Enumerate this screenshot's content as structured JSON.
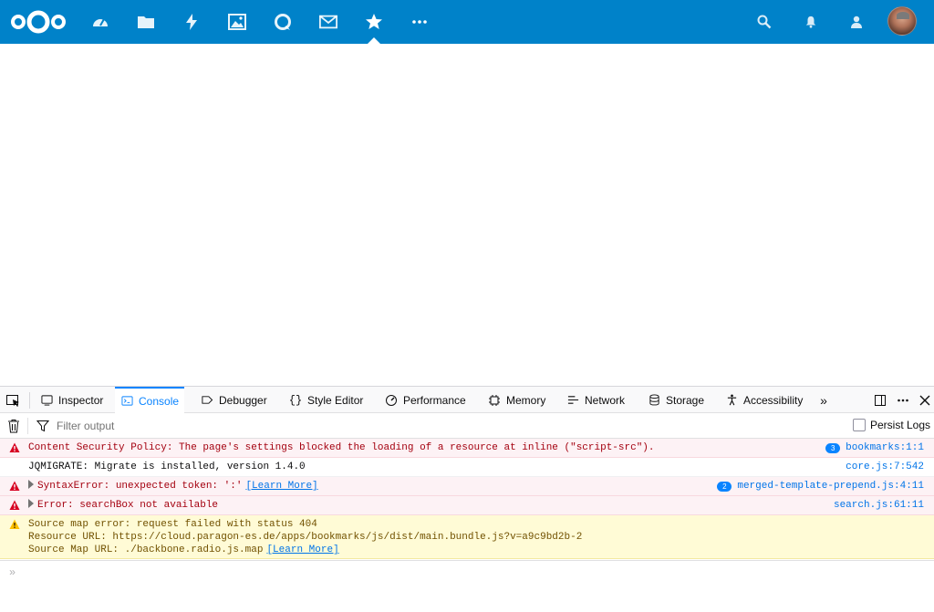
{
  "colors": {
    "header_bg": "#0082c9",
    "devtools_accent": "#0a84ff",
    "error_text": "#a4000f",
    "error_bg": "#fdf2f5",
    "warn_text": "#715100",
    "warn_bg": "#fffbd6",
    "link": "#0074e8"
  },
  "header": {
    "logo_icon": "nextcloud-logo",
    "apps": [
      {
        "icon": "dashboard-icon",
        "active": false
      },
      {
        "icon": "files-icon",
        "active": false
      },
      {
        "icon": "activity-icon",
        "active": false
      },
      {
        "icon": "photos-icon",
        "active": false
      },
      {
        "icon": "talk-icon",
        "active": false
      },
      {
        "icon": "mail-icon",
        "active": false
      },
      {
        "icon": "bookmarks-star-icon",
        "active": true
      },
      {
        "icon": "more-apps-icon",
        "active": false
      }
    ],
    "right_icons": [
      "search-icon",
      "notifications-icon",
      "contacts-icon"
    ],
    "avatar_icon": "user-avatar"
  },
  "devtools": {
    "tabs": {
      "inspector": "Inspector",
      "console": "Console",
      "debugger": "Debugger",
      "style_editor": "Style Editor",
      "performance": "Performance",
      "memory": "Memory",
      "network": "Network",
      "storage": "Storage",
      "accessibility": "Accessibility"
    },
    "active_tab": "Console",
    "filter": {
      "placeholder": "Filter output",
      "value": ""
    },
    "persist_logs": {
      "label": "Persist Logs",
      "checked": false
    },
    "messages": [
      {
        "level": "error",
        "text": "Content Security Policy: The page's settings blocked the loading of a resource at inline (\"script-src\").",
        "count": "3",
        "source": "bookmarks:1:1"
      },
      {
        "level": "log",
        "text": "JQMIGRATE: Migrate is installed, version 1.4.0",
        "source": "core.js:7:542"
      },
      {
        "level": "error",
        "text": "SyntaxError: unexpected token: ':'",
        "learn_more": "[Learn More]",
        "count": "2",
        "source": "merged-template-prepend.js:4:11"
      },
      {
        "level": "error",
        "text": "Error: searchBox not available",
        "source": "search.js:61:11"
      },
      {
        "level": "warn",
        "line1": "Source map error: request failed with status 404",
        "line2": "Resource URL: https://cloud.paragon-es.de/apps/bookmarks/js/dist/main.bundle.js?v=a9c9bd2b-2",
        "line3": "Source Map URL: ./backbone.radio.js.map",
        "learn_more": "[Learn More]"
      }
    ],
    "input_prompt": "»"
  }
}
